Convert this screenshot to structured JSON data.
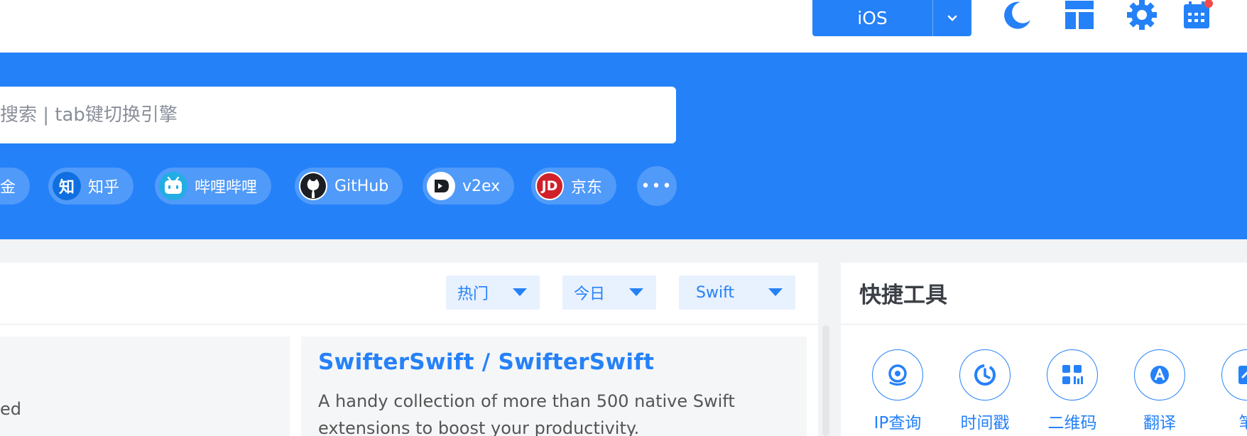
{
  "header": {
    "platform_select": {
      "value": "iOS"
    },
    "icons": [
      "moon-icon",
      "layout-icon",
      "gear-icon",
      "calendar-icon"
    ],
    "accent": "#2581f8"
  },
  "search": {
    "placeholder": "搜索 | tab键切换引擎"
  },
  "quick_links": [
    {
      "label": "金"
    },
    {
      "label": "知乎",
      "logo_text": "知"
    },
    {
      "label": "哔哩哔哩"
    },
    {
      "label": "GitHub"
    },
    {
      "label": "v2ex"
    },
    {
      "label": "京东",
      "logo_text": "JD"
    }
  ],
  "more_label": "•••",
  "filters": [
    "热门",
    "今日",
    "Swift"
  ],
  "cards": {
    "left_fragment": "ed",
    "right": {
      "title": "SwifterSwift / SwifterSwift",
      "description": "A handy collection of more than 500 native Swift extensions to boost your productivity."
    }
  },
  "tools": {
    "title": "快捷工具",
    "items": [
      {
        "label": "IP查询",
        "icon": "location-icon"
      },
      {
        "label": "时间戳",
        "icon": "clock-icon"
      },
      {
        "label": "二维码",
        "icon": "qrcode-icon"
      },
      {
        "label": "翻译",
        "icon": "translate-icon"
      },
      {
        "label": "笔",
        "icon": "note-icon"
      }
    ]
  }
}
